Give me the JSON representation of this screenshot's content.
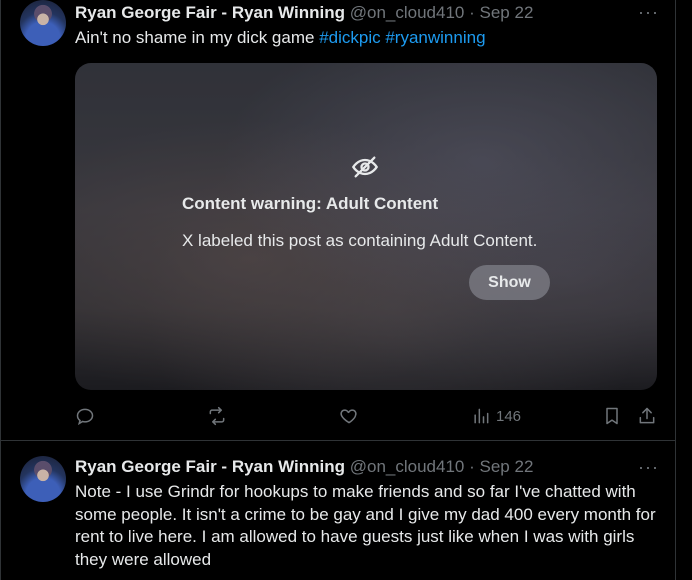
{
  "posts": [
    {
      "author_name": "Ryan George Fair - Ryan Winning",
      "handle": "@on_cloud410",
      "separator": "·",
      "date": "Sep 22",
      "text_prefix": "Ain't no shame in my dick game ",
      "hashtags": [
        "#dickpic",
        "#ryanwinning"
      ],
      "content_warning": {
        "title": "Content warning: Adult Content",
        "description": "X labeled this post as containing Adult Content.",
        "show_label": "Show"
      },
      "views": "146"
    },
    {
      "author_name": "Ryan George Fair - Ryan Winning",
      "handle": "@on_cloud410",
      "separator": "·",
      "date": "Sep 22",
      "text": "Note - I use Grindr for hookups to make friends and so far I've chatted with some people. It isn't a crime to be gay and I give my dad 400 every month for rent to live here. I am allowed to have guests just like when I was with girls they were allowed"
    }
  ],
  "icons": {
    "more": "more-icon",
    "reply": "reply-icon",
    "repost": "repost-icon",
    "like": "like-icon",
    "views": "views-icon",
    "bookmark": "bookmark-icon",
    "share": "share-icon",
    "eye_off": "eye-off-icon"
  },
  "colors": {
    "background": "#000000",
    "text": "#e7e9ea",
    "muted": "#71767b",
    "link": "#1d9bf0",
    "border": "#2f3336"
  }
}
